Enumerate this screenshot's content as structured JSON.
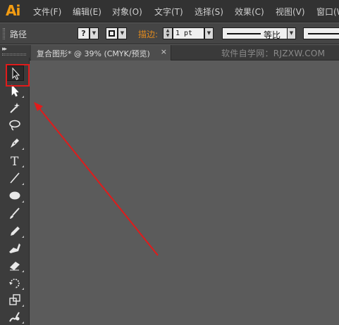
{
  "app": {
    "logo": "Ai"
  },
  "menubar": {
    "items": [
      {
        "label": "文件(F)"
      },
      {
        "label": "编辑(E)"
      },
      {
        "label": "对象(O)"
      },
      {
        "label": "文字(T)"
      },
      {
        "label": "选择(S)"
      },
      {
        "label": "效果(C)"
      },
      {
        "label": "视图(V)"
      },
      {
        "label": "窗口(W)"
      }
    ]
  },
  "controlbar": {
    "selection_label": "路径",
    "fill_state": "?",
    "stroke_label": "描边:",
    "stroke_weight": "1 pt",
    "stroke_profile": "等比"
  },
  "document": {
    "tab_label": "复合图形* @ 39% (CMYK/预览)",
    "close_glyph": "×",
    "watermark": "软件自学网：RJZXW.COM"
  },
  "toolbar": {
    "collapse_glyph": "▸▸",
    "tools": [
      {
        "name": "selection-tool",
        "icon": "arrow-pointer-icon",
        "active": true
      },
      {
        "name": "direct-selection-tool",
        "icon": "white-arrow-icon"
      },
      {
        "name": "magic-wand-tool",
        "icon": "magic-wand-icon"
      },
      {
        "name": "lasso-tool",
        "icon": "lasso-icon"
      },
      {
        "name": "pen-tool",
        "icon": "pen-nib-icon"
      },
      {
        "name": "type-tool",
        "icon": "type-t-icon",
        "glyph": "T"
      },
      {
        "name": "line-segment-tool",
        "icon": "line-icon"
      },
      {
        "name": "ellipse-tool",
        "icon": "ellipse-icon"
      },
      {
        "name": "paintbrush-tool",
        "icon": "paintbrush-icon"
      },
      {
        "name": "pencil-tool",
        "icon": "pencil-icon"
      },
      {
        "name": "blob-brush-tool",
        "icon": "blob-brush-icon"
      },
      {
        "name": "eraser-tool",
        "icon": "eraser-icon"
      },
      {
        "name": "rotate-tool",
        "icon": "rotate-icon"
      },
      {
        "name": "scale-tool",
        "icon": "scale-icon"
      },
      {
        "name": "warp-tool",
        "icon": "warp-icon"
      }
    ]
  },
  "annotation": {
    "color": "#e11b1b"
  }
}
